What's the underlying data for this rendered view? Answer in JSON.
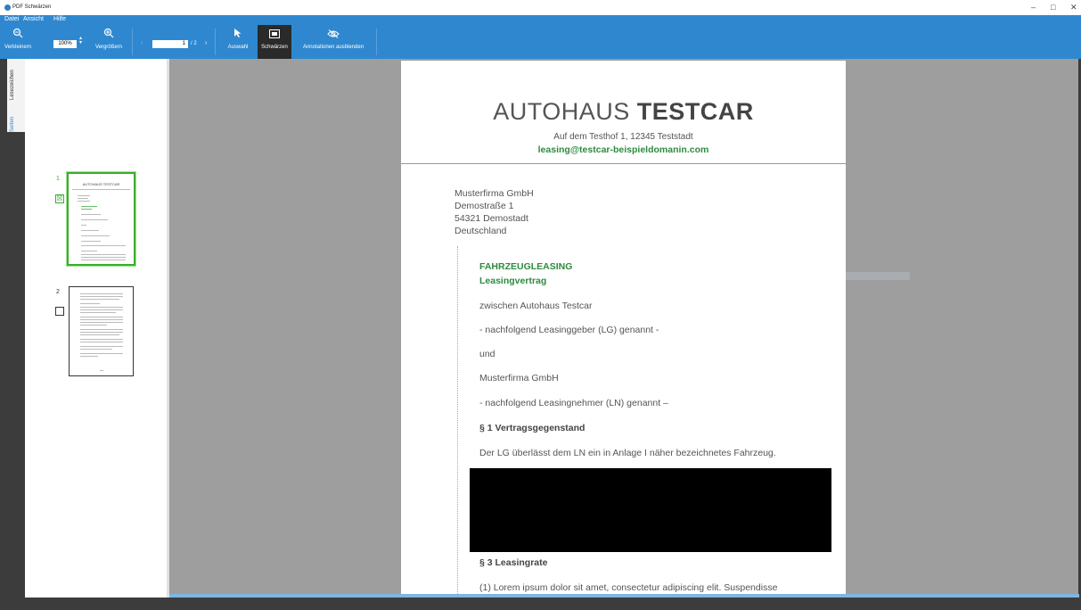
{
  "window": {
    "title": "PDF Schwärzen",
    "minimize": "–",
    "maximize": "□",
    "close": "✕"
  },
  "menu": {
    "items": [
      "Datei",
      "Ansicht",
      "Hilfe"
    ]
  },
  "toolbar": {
    "zoom_out_label": "Verkleinern",
    "zoom_value": "100%",
    "zoom_in_label": "Vergrößern",
    "prev_page": "‹",
    "current_page": "1",
    "page_total": "/ 2",
    "next_page": "›",
    "select_label": "Auswahl",
    "redact_label": "Schwärzen",
    "hide_annotations_label": "Annotationen ausblenden"
  },
  "side_tabs": {
    "bookmarks": "Lesezeichen",
    "pages": "Seiten"
  },
  "thumbnails": [
    {
      "number": "1",
      "checked": true,
      "selected": true,
      "title": "AUTOHAUS TESTCAR"
    },
    {
      "number": "2",
      "checked": false,
      "selected": false
    }
  ],
  "document": {
    "company_light": "AUTOHAUS ",
    "company_bold": "TESTCAR",
    "address_line": "Auf dem Testhof 1, 12345 Teststadt",
    "email": "leasing@testcar-beispieldomanin.com",
    "recipient": [
      "Musterfirma GmbH",
      "Demostraße 1",
      "54321 Demostadt",
      "Deutschland"
    ],
    "heading1": "FAHRZEUGLEASING",
    "heading2": "Leasingvertrag",
    "para1": "zwischen Autohaus Testcar",
    "para2": "- nachfolgend Leasinggeber (LG) genannt -",
    "para3": "und",
    "para4": "Musterfirma GmbH",
    "para5": "- nachfolgend Leasingnehmer (LN) genannt –",
    "section1_title": "§ 1 Vertragsgegenstand",
    "section1_text": "Der LG überlässt dem LN ein in Anlage I näher bezeichnetes Fahrzeug.",
    "section3_title": "§ 3 Leasingrate",
    "section3_text": "(1) Lorem ipsum dolor sit amet, consectetur adipiscing elit. Suspendisse"
  },
  "colors": {
    "accent": "#2f88cf",
    "brand_green": "#2e8b3e",
    "selection_green": "#3aae2c"
  },
  "icons": {
    "zoom_out": "zoom-out-icon",
    "zoom_in": "zoom-in-icon",
    "select": "cursor-icon",
    "redact": "redact-box-icon",
    "hide": "eye-slash-icon"
  }
}
